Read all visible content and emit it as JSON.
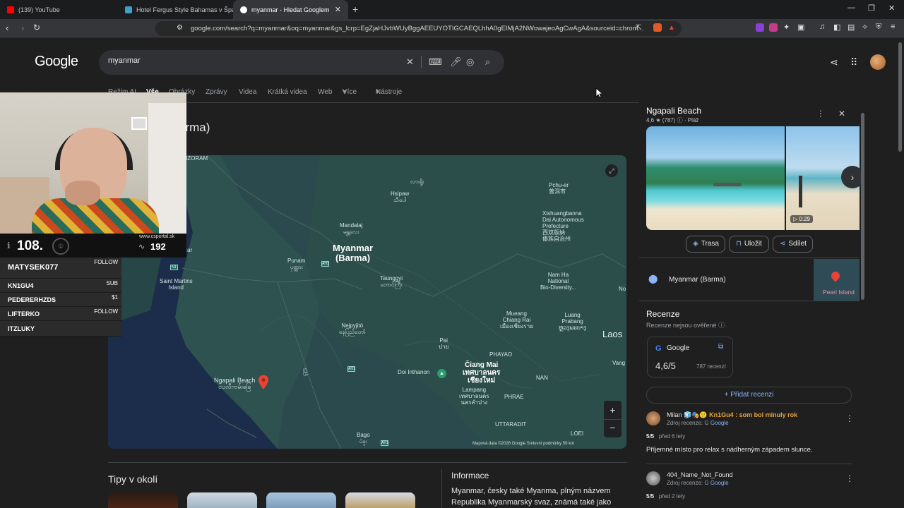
{
  "browser": {
    "tabs": [
      {
        "title": "(139) YouTube",
        "color": "#ff0000"
      },
      {
        "title": "Hotel Fergus Style Bahamas v Španěl",
        "color": "#3ca0c8"
      },
      {
        "title": "myanmar - Hledat Googlem",
        "color": "#ffffff"
      }
    ],
    "url": "google.com/search?q=myanmar&oq=myanmar&gs_lcrp=EgZjaHJvbWUyBggAEEUYOTIGCAEQLhhA0gEIMjA2NWowajeoAgCwAgA&sourceid=chrom..."
  },
  "google": {
    "logo": "Google",
    "query": "myanmar",
    "filters": [
      "Režim AI",
      "Vše",
      "Obrázky",
      "Zprávy",
      "Videa",
      "Krátká videa",
      "Web",
      "Více",
      "Nástroje"
    ],
    "page_title_partial": "arma)"
  },
  "stream_overlay": {
    "rank": "108.",
    "site": "www.csportal.sk",
    "count": "192",
    "leaderboard": [
      {
        "name": "MATYSEK077",
        "tag": "FOLLOW"
      },
      {
        "name": "KN1GU4",
        "tag": "SUB"
      },
      {
        "name": "PEDERERHZDS",
        "tag": "$1"
      },
      {
        "name": "LIFTERKO",
        "tag": "FOLLOW"
      },
      {
        "name": "ITZLUKY",
        "tag": ""
      }
    ]
  },
  "map": {
    "labels": {
      "mizoram": "IZORAM",
      "zar": "zar",
      "myanmar": "Myanmar\n(Barma)",
      "mandalaj": "Mandalaj\nမန္တလေး",
      "hsipaw": "Hsipaw\nသီပေါ",
      "putao_script": "လားရှိုး",
      "pchu": "Pchu-er\n普洱市",
      "xishuang": "Xishuangbanna\nDai Autonomous\nPrefecture\n西双版纳\n傣族自治州",
      "punam": "Punam\nပုဏ္ဏား",
      "taunggyi": "Taunggyi\nတောင်ကြီး",
      "stmartin": "Saint Martins\nIsland",
      "namha": "Nam Ha\nNational\nBio-Diversity...",
      "no": "No",
      "luang": "Luang\nPrabang\nຫຼວງພະບາງ",
      "laos": "Laos",
      "naypyi": "Nejpyjitó\nနေပြည်တော်",
      "mueang": "Mueang\nChiang Rai\nเมืองเชียงราย",
      "pai": "Pai\nปาย",
      "phayao": "PHAYAO",
      "chiangmai": "Čiang Mai\nเทศบาลนคร\nเชียงใหม่",
      "doiinthanon": "Doi Inthanon",
      "nan": "NAN",
      "lampang": "Lampang\nเทศบาลนคร\nนครลำปาง",
      "phrae": "PHRAE",
      "vang": "Vang",
      "ngapali": "Ngapali Beach\nငပလီကမ်းခြေ",
      "uttaradit": "UTTARADIT",
      "loei": "LOEI",
      "bago": "Bago\nပဲခူး",
      "script_mid": "မြို့"
    },
    "footer": "Mapová data ©2026 Google    Smluvní podmínky    50 km"
  },
  "sections": {
    "tips": "Tipy v okolí",
    "info_heading": "Informace",
    "info_text": "Myanmar, česky také Myanma, plným názvem Republika Myanmarský svaz, známá také jako"
  },
  "knowledge_panel": {
    "title": "Ngapali Beach",
    "rating_line": "4,6 ★ (787) ⓘ · Pláž",
    "video_length": "▷ 0:29",
    "actions": [
      {
        "icon": "◈",
        "label": "Trasa"
      },
      {
        "icon": "⊓",
        "label": "Uložit"
      },
      {
        "icon": "⋖",
        "label": "Sdílet"
      }
    ],
    "location": "Myanmar (Barma)",
    "minimap_label": "Pearl Island",
    "reviews_heading": "Recenze",
    "reviews_note": "Recenze nejsou ověřené ⓘ",
    "google_card": {
      "source": "Google",
      "score": "4,6/5",
      "count": "787 recenzí"
    },
    "add_review": "+ Přidat recenzi",
    "reviews": [
      {
        "name": "Milan",
        "comment": "Kn1Gu4 : som bol minuly rok",
        "source_prefix": "Zdroj recenze:",
        "source": "Google",
        "score": "5/5",
        "when": "před 6 lety",
        "body": "Příjemné místo pro relax s nádherným západem slunce."
      },
      {
        "name": "404_Name_Not_Found",
        "comment": "",
        "source_prefix": "Zdroj recenze:",
        "source": "Google",
        "score": "5/5",
        "when": "před 2 lety",
        "body": ""
      }
    ]
  },
  "colors": {
    "accent": "#8ab4f8",
    "map_water": "#1f2f4a",
    "map_land": "#2a4a4d",
    "pin": "#ea4335"
  }
}
